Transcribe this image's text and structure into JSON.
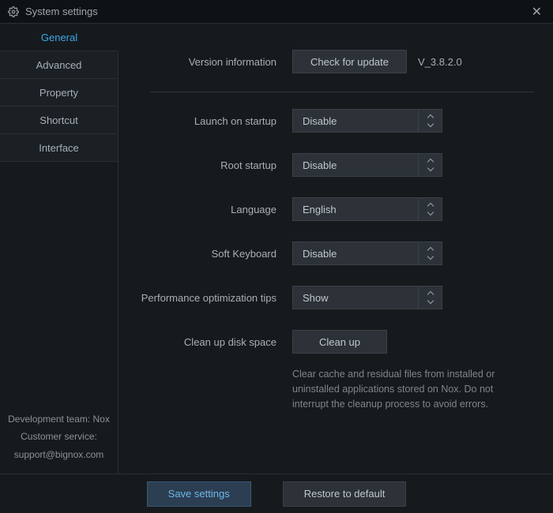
{
  "window": {
    "title": "System settings"
  },
  "sidebar": {
    "tabs": [
      {
        "label": "General",
        "active": true
      },
      {
        "label": "Advanced",
        "active": false
      },
      {
        "label": "Property",
        "active": false
      },
      {
        "label": "Shortcut",
        "active": false
      },
      {
        "label": "Interface",
        "active": false
      }
    ],
    "dev_team": "Development team: Nox",
    "customer_service": "Customer service:",
    "support_email": "support@bignox.com"
  },
  "settings": {
    "version_label": "Version information",
    "check_update_btn": "Check for update",
    "version_value": "V_3.8.2.0",
    "launch_label": "Launch on startup",
    "launch_value": "Disable",
    "root_label": "Root startup",
    "root_value": "Disable",
    "language_label": "Language",
    "language_value": "English",
    "softkb_label": "Soft Keyboard",
    "softkb_value": "Disable",
    "perf_label": "Performance optimization tips",
    "perf_value": "Show",
    "cleanup_label": "Clean up disk space",
    "cleanup_btn": "Clean up",
    "cleanup_hint": "Clear cache and residual files from installed or uninstalled applications stored on Nox. Do not interrupt the cleanup process to avoid errors."
  },
  "footer": {
    "save": "Save settings",
    "restore": "Restore to default"
  }
}
